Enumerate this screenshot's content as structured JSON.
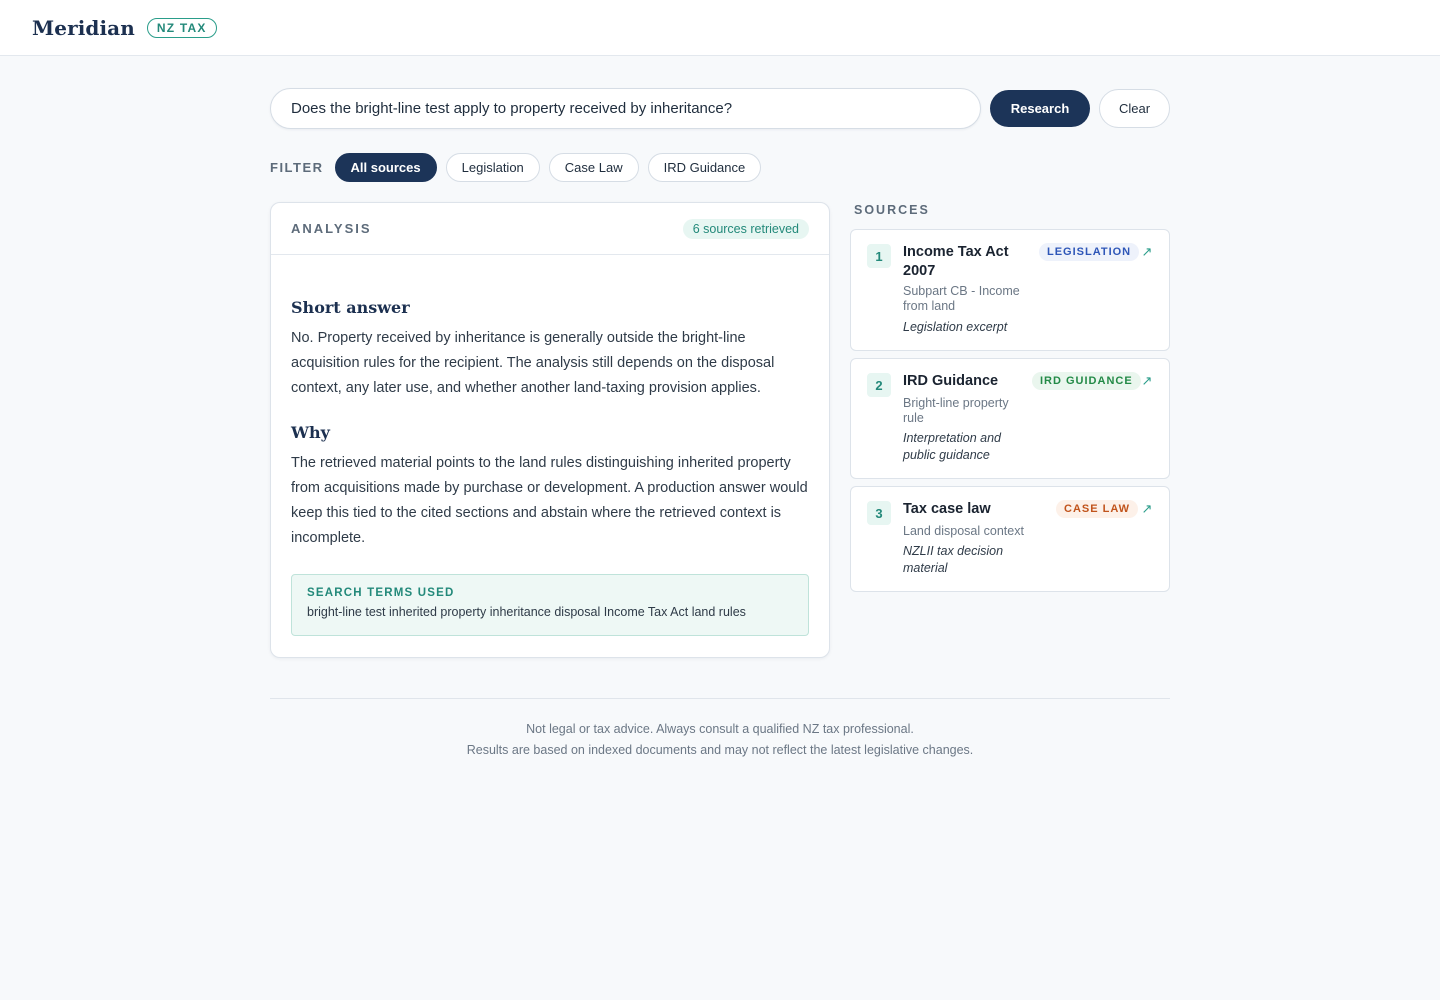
{
  "header": {
    "brand": "Meridian",
    "badge": "NZ TAX"
  },
  "search": {
    "query": "Does the bright-line test apply to property received by inheritance?",
    "research_label": "Research",
    "clear_label": "Clear"
  },
  "filter": {
    "label": "FILTER",
    "chips": [
      "All sources",
      "Legislation",
      "Case Law",
      "IRD Guidance"
    ],
    "active": "All sources"
  },
  "analysis": {
    "title": "ANALYSIS",
    "badge": "6 sources retrieved",
    "short_answer_heading": "Short answer",
    "short_answer": "No. Property received by inheritance is generally outside the bright-line acquisition rules for the recipient. The analysis still depends on the disposal context, any later use, and whether another land-taxing provision applies.",
    "why_heading": "Why",
    "why": "The retrieved material points to the land rules distinguishing inherited property from acquisitions made by purchase or development. A production answer would keep this tied to the cited sections and abstain where the retrieved context is incomplete.",
    "terms_title": "SEARCH TERMS USED",
    "terms": "bright-line test inherited property inheritance disposal Income Tax Act land rules"
  },
  "sources": {
    "label": "SOURCES",
    "items": [
      {
        "num": "1",
        "title": "Income Tax Act 2007",
        "subtitle": "Subpart CB - Income from land",
        "type": "Legislation excerpt",
        "tag": "LEGISLATION"
      },
      {
        "num": "2",
        "title": "IRD Guidance",
        "subtitle": "Bright-line property rule",
        "type": "Interpretation and public guidance",
        "tag": "IRD GUIDANCE"
      },
      {
        "num": "3",
        "title": "Tax case law",
        "subtitle": "Land disposal context",
        "type": "NZLII tax decision material",
        "tag": "CASE LAW"
      }
    ]
  },
  "footer": {
    "line1": "Not legal or tax advice. Always consult a qualified NZ tax professional.",
    "line2": "Results are based on indexed documents and may not reflect the latest legislative changes."
  },
  "colors": {
    "navy": "#1c3458",
    "teal": "#23897a",
    "legislation": "#2e56b8",
    "ird": "#238a47",
    "case_law": "#c1541c"
  },
  "icons": {
    "source_link": "external-link-icon"
  }
}
